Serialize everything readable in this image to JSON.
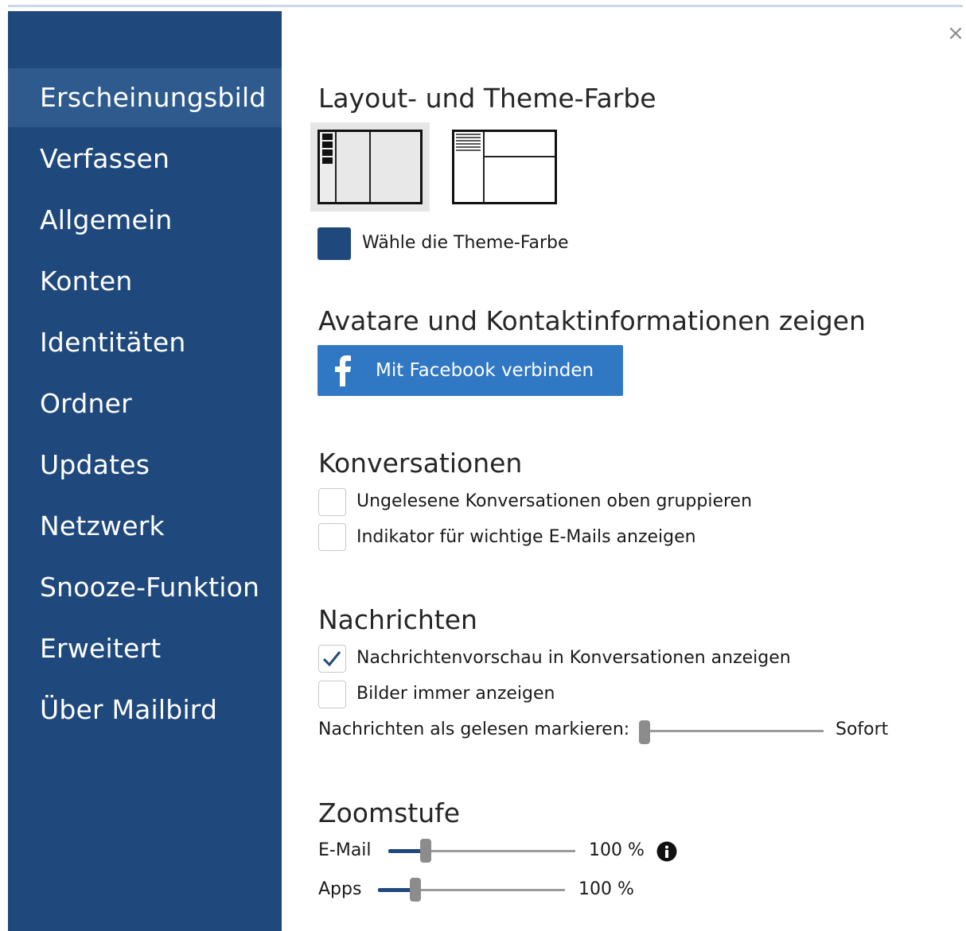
{
  "sidebar": {
    "items": [
      {
        "label": "Erscheinungsbild",
        "active": true
      },
      {
        "label": "Verfassen"
      },
      {
        "label": "Allgemein"
      },
      {
        "label": "Konten"
      },
      {
        "label": "Identitäten"
      },
      {
        "label": "Ordner"
      },
      {
        "label": "Updates"
      },
      {
        "label": "Netzwerk"
      },
      {
        "label": "Snooze-Funktion"
      },
      {
        "label": "Erweitert"
      },
      {
        "label": "Über Mailbird"
      }
    ]
  },
  "close_label": "×",
  "layout_section": {
    "title": "Layout- und Theme-Farbe",
    "theme_label": "Wähle die Theme-Farbe",
    "theme_color": "#1f497d"
  },
  "avatar_section": {
    "title": "Avatare und Kontaktinformationen zeigen",
    "facebook_label": "Mit Facebook verbinden"
  },
  "conversations": {
    "title": "Konversationen",
    "options": [
      {
        "label": "Ungelesene Konversationen oben gruppieren",
        "checked": false
      },
      {
        "label": "Indikator für wichtige E-Mails anzeigen",
        "checked": false
      }
    ]
  },
  "messages": {
    "title": "Nachrichten",
    "options": [
      {
        "label": "Nachrichtenvorschau in Konversationen anzeigen",
        "checked": true
      },
      {
        "label": "Bilder immer anzeigen",
        "checked": false
      }
    ],
    "mark_read_label": "Nachrichten als gelesen markieren:",
    "mark_read_value": "Sofort",
    "mark_read_level": 0
  },
  "zoom": {
    "title": "Zoomstufe",
    "email_label": "E-Mail",
    "email_value": "100 %",
    "email_level": 0.2,
    "apps_label": "Apps",
    "apps_value": "100 %",
    "apps_level": 0.2
  },
  "colors": {
    "sidebar_bg": "#1f497d",
    "sidebar_active": "#2e5a8e",
    "facebook_blue": "#3077c4"
  },
  "icons": {
    "close": "close-icon",
    "facebook": "facebook-icon",
    "check": "check-icon",
    "info": "info-icon"
  }
}
